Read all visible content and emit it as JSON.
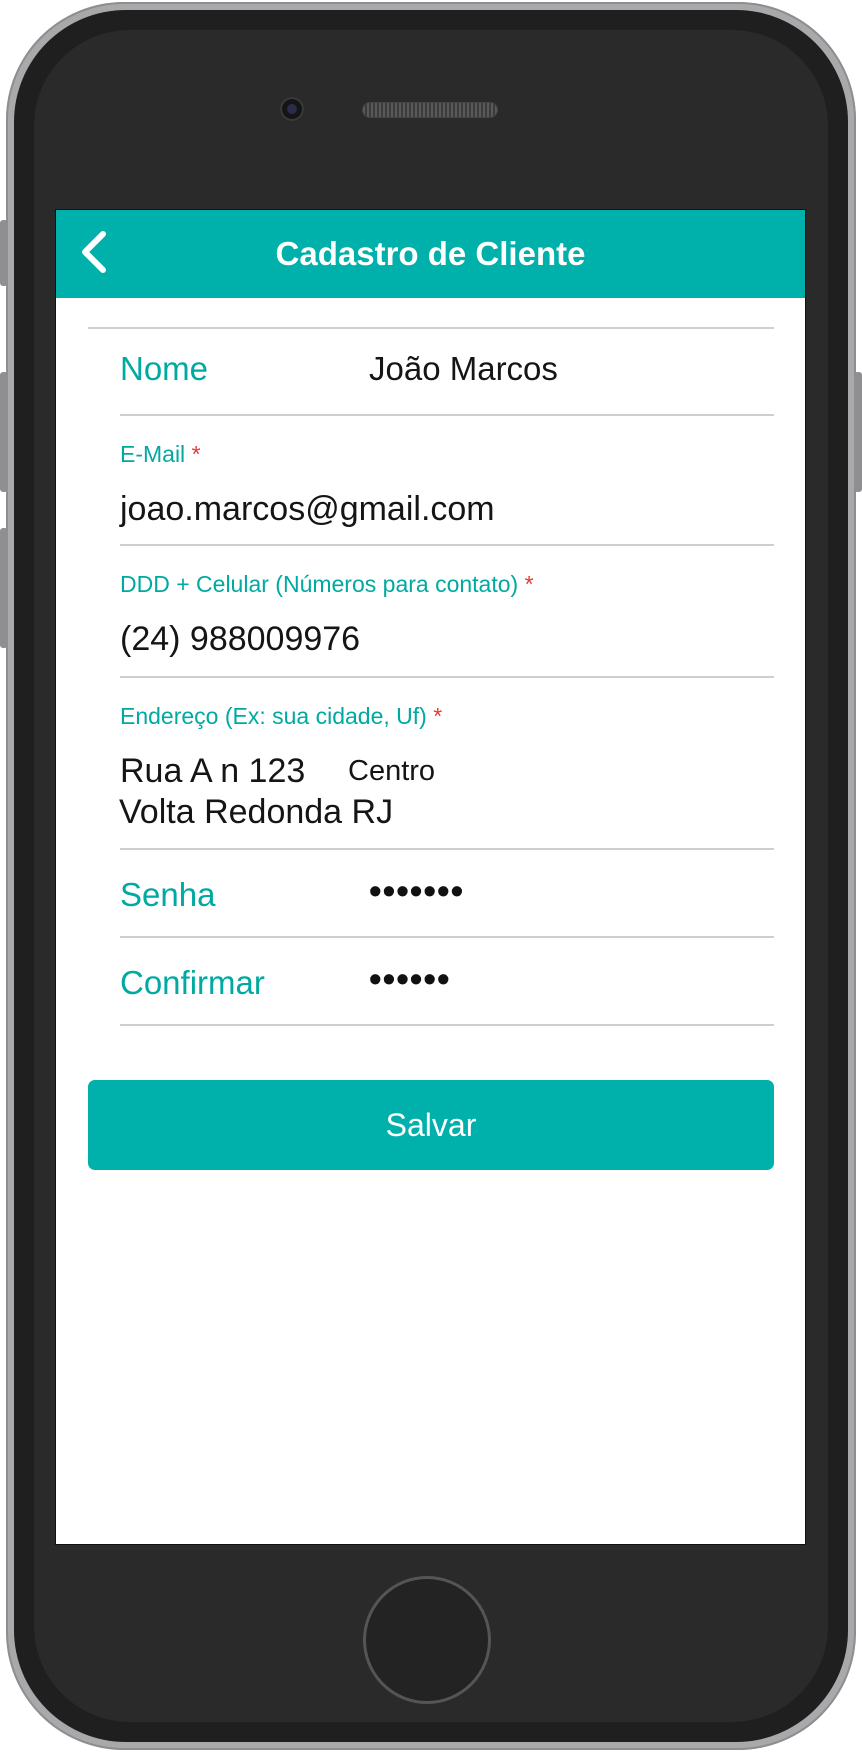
{
  "header": {
    "title": "Cadastro de Cliente",
    "back_icon": "chevron-left-icon"
  },
  "form": {
    "nome": {
      "label": "Nome",
      "value": "João Marcos"
    },
    "email": {
      "label": "E-Mail",
      "required_mark": "*",
      "value": "joao.marcos@gmail.com"
    },
    "celular": {
      "label": "DDD + Celular (Números para contato)",
      "required_mark": "*",
      "value": "(24) 988009976"
    },
    "endereco": {
      "label": "Endereço (Ex: sua cidade, Uf)",
      "required_mark": "*",
      "line1": "Rua A n 123",
      "line1_extra": "Centro",
      "line2": "Volta Redonda RJ"
    },
    "senha": {
      "label": "Senha",
      "masked_value": "•••••••"
    },
    "confirmar": {
      "label": "Confirmar",
      "masked_value": "••••••"
    }
  },
  "actions": {
    "save_label": "Salvar"
  },
  "colors": {
    "accent": "#00b0aa",
    "label": "#00a9a1",
    "required": "#e53935"
  }
}
